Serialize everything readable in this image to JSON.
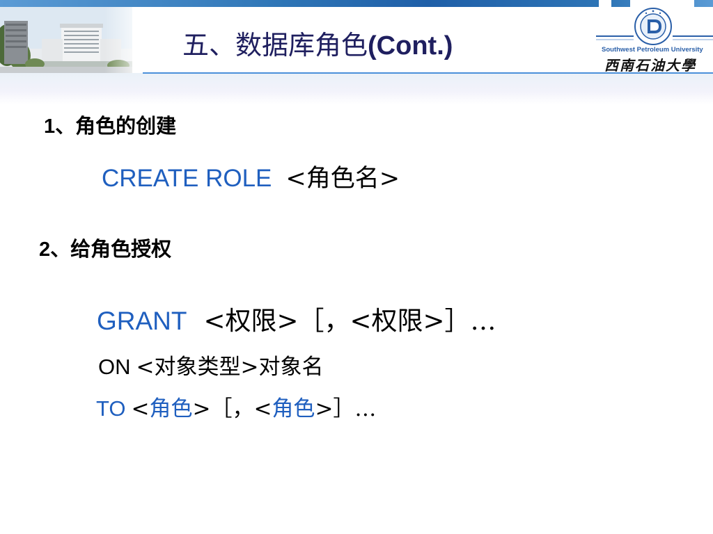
{
  "header": {
    "title_cn": "五、数据库角色",
    "title_latin": "(Cont.)",
    "university_en": "Southwest Petroleum University",
    "university_cn": "西南石油大學"
  },
  "section1": {
    "heading_num": "1",
    "heading_text": "、角色的创建",
    "code_keyword": "CREATE  ROLE",
    "code_rest": "<角色名>"
  },
  "section2": {
    "heading_num": "2",
    "heading_text": "、给角色授权",
    "grant_keyword": "GRANT",
    "grant_rest": "<权限>［，<权限>］…",
    "on_keyword": "ON",
    "on_rest": "<对象类型>对象名",
    "to_keyword": "TO",
    "to_lt1": "<",
    "to_role1": "角色",
    "to_mid": ">［，<",
    "to_role2": "角色",
    "to_end": ">］…"
  },
  "colors": {
    "title": "#1f1f5f",
    "keyword_blue": "#1f5fbf",
    "accent_line": "#4a90d9",
    "logo_blue": "#2a5fa8"
  }
}
